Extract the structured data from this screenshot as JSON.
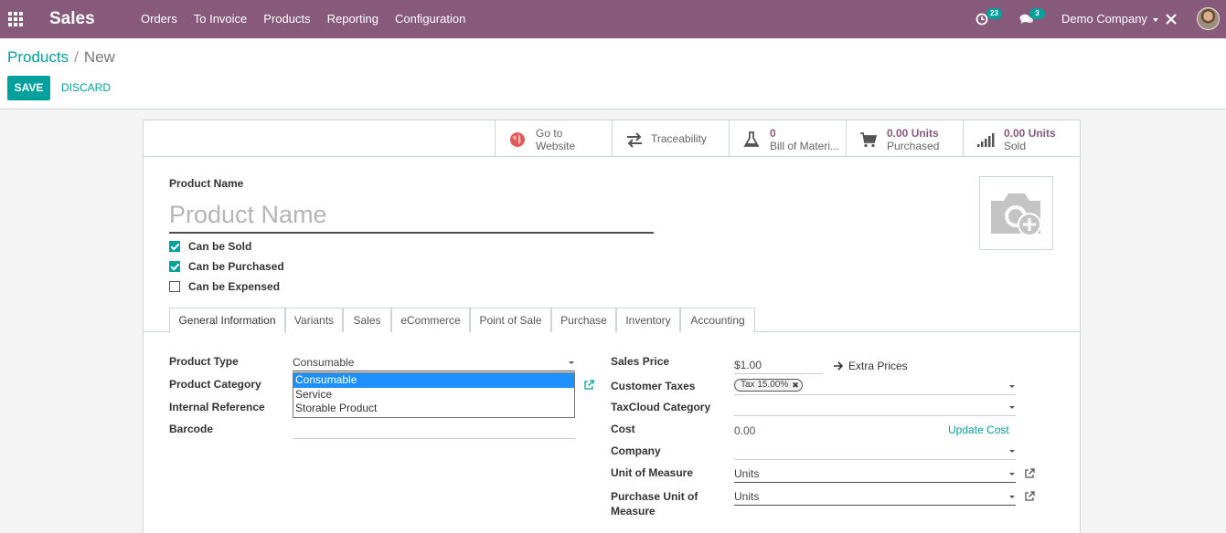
{
  "navbar": {
    "app_name": "Sales",
    "menu": [
      "Orders",
      "To Invoice",
      "Products",
      "Reporting",
      "Configuration"
    ],
    "activity_count": "23",
    "message_count": "3",
    "company": "Demo Company",
    "color": "#875a7b"
  },
  "breadcrumb": {
    "parent": "Products",
    "separator": "/",
    "current": "New"
  },
  "buttons": {
    "save": "SAVE",
    "discard": "DISCARD",
    "accent_color": "#00a09d"
  },
  "smart_buttons": {
    "website": {
      "line1": "Go to",
      "line2": "Website",
      "icon": "globe-icon"
    },
    "traceability": {
      "label": "Traceability",
      "icon": "arrows-exchange-icon"
    },
    "bom": {
      "value": "0",
      "label": "Bill of Materi...",
      "icon": "flask-icon"
    },
    "purchased": {
      "value": "0.00 Units",
      "label": "Purchased",
      "icon": "shopping-cart-icon"
    },
    "sold": {
      "value": "0.00 Units",
      "label": "Sold",
      "icon": "signal-bars-icon"
    }
  },
  "product": {
    "name_label": "Product Name",
    "name_placeholder": "Product Name",
    "checkboxes": [
      {
        "label": "Can be Sold",
        "checked": true
      },
      {
        "label": "Can be Purchased",
        "checked": true
      },
      {
        "label": "Can be Expensed",
        "checked": false
      }
    ]
  },
  "tabs": [
    "General Information",
    "Variants",
    "Sales",
    "eCommerce",
    "Point of Sale",
    "Purchase",
    "Inventory",
    "Accounting"
  ],
  "general": {
    "product_type_label": "Product Type",
    "product_type_value": "Consumable",
    "product_type_options": [
      "Consumable",
      "Service",
      "Storable Product"
    ],
    "product_category_label": "Product Category",
    "internal_reference_label": "Internal Reference",
    "barcode_label": "Barcode",
    "sales_price_label": "Sales Price",
    "sales_price_value": "$1.00",
    "extra_prices": "Extra Prices",
    "customer_taxes_label": "Customer Taxes",
    "tax_tag": "Tax 15.00%",
    "taxcloud_label": "TaxCloud Category",
    "cost_label": "Cost",
    "cost_value": "0.00",
    "update_cost": "Update Cost",
    "company_label": "Company",
    "uom_label": "Unit of Measure",
    "uom_value": "Units",
    "purchase_uom_label_1": "Purchase Unit of",
    "purchase_uom_label_2": "Measure",
    "purchase_uom_value": "Units"
  }
}
